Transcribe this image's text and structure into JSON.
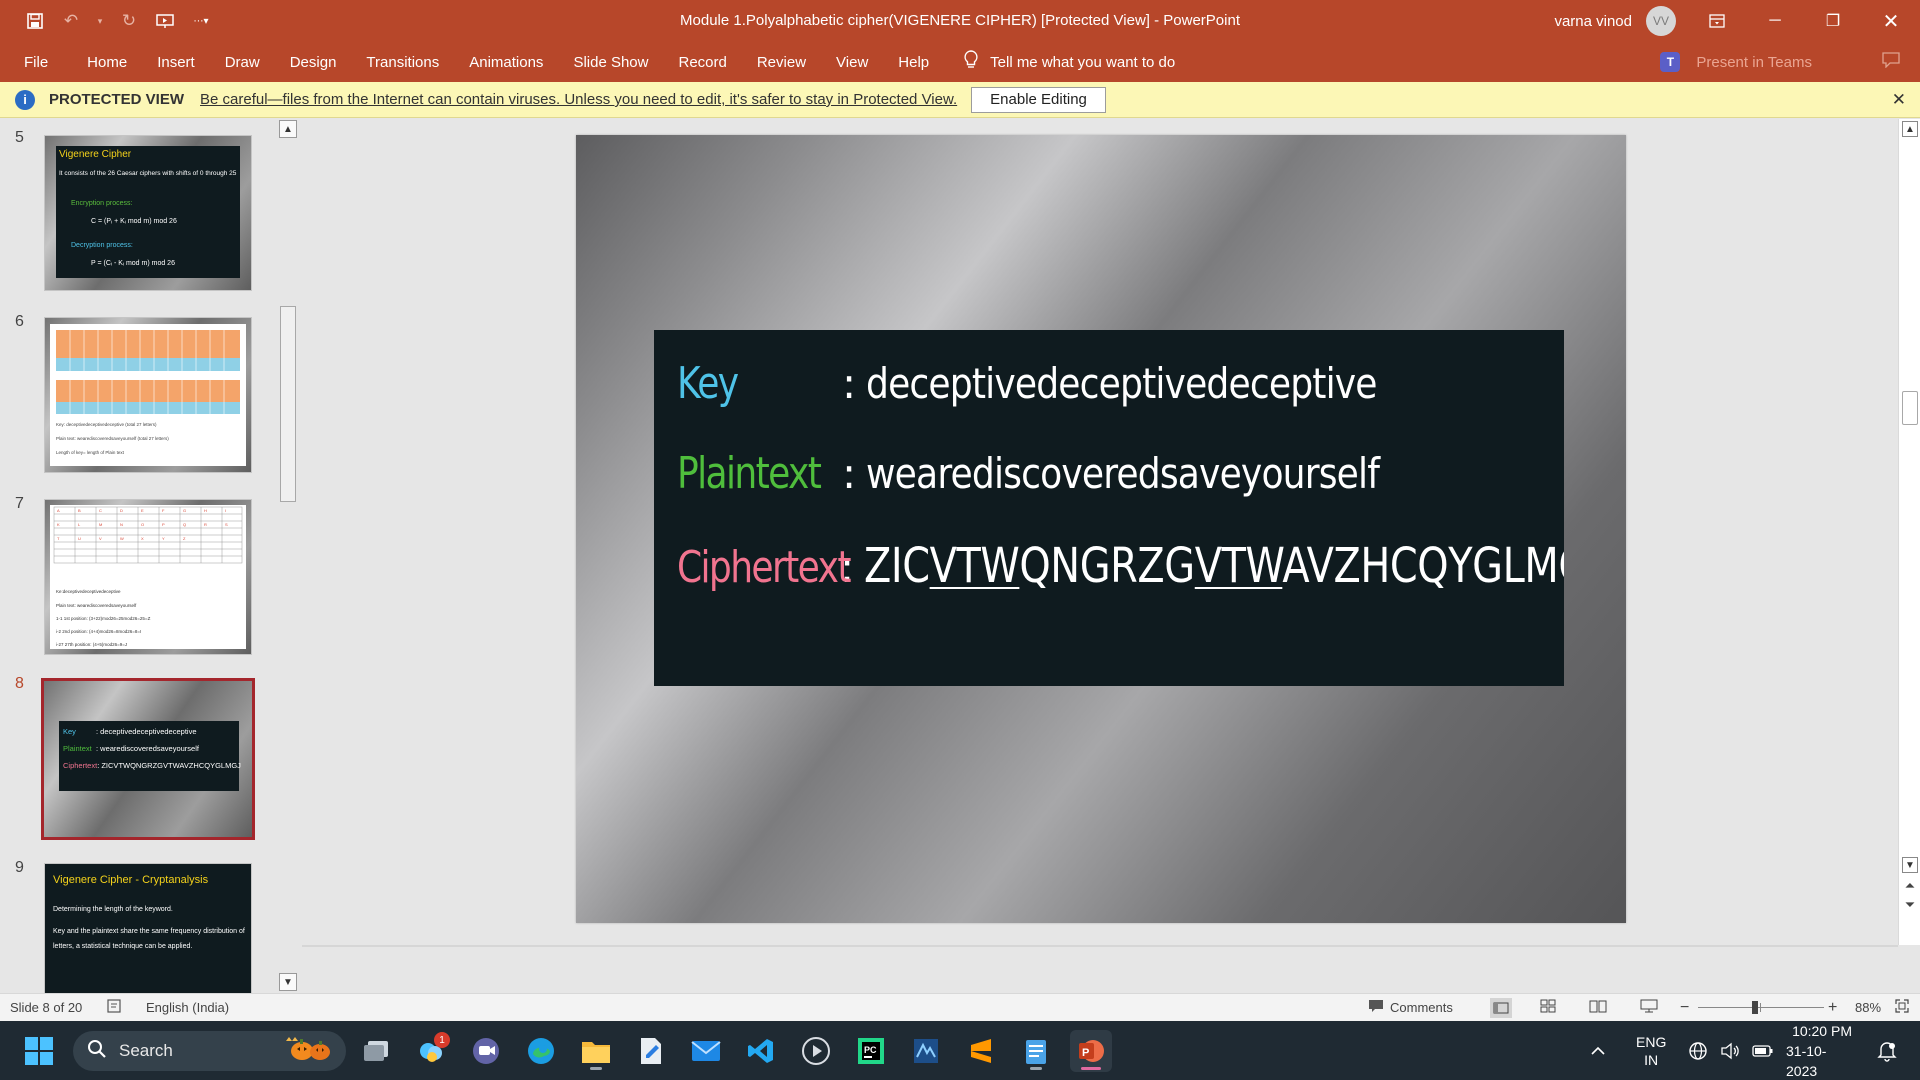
{
  "window": {
    "title": "Module 1.Polyalphabetic cipher(VIGENERE CIPHER) [Protected View]  -  PowerPoint",
    "user_name": "varna vinod",
    "user_initials": "VV"
  },
  "ribbon": {
    "file": "File",
    "tabs": [
      "Home",
      "Insert",
      "Draw",
      "Design",
      "Transitions",
      "Animations",
      "Slide Show",
      "Record",
      "Review",
      "View",
      "Help"
    ],
    "tell_me": "Tell me what you want to do",
    "present_in_teams": "Present in Teams"
  },
  "protected_view": {
    "label": "PROTECTED VIEW",
    "message": "Be careful—files from the Internet can contain viruses. Unless you need to edit, it's safer to stay in Protected View.",
    "button": "Enable Editing"
  },
  "thumbnails": [
    {
      "number": "5",
      "title": "Vigenere Cipher",
      "bullet": "It consists of the 26 Caesar ciphers with shifts of 0 through 25",
      "enc_label": "Encryption process:",
      "enc_formula": "C = (Pᵢ + Kᵢ mod m) mod 26",
      "dec_label": "Decryption process:",
      "dec_formula": "P = (Cᵢ - Kᵢ mod m) mod 26"
    },
    {
      "number": "6",
      "key_line": "Key: deceptivedeceptivedeceptive (total 27 letters)",
      "plain_line": "Plain text: wearediscoveredsaveyourself  (total 27 letters)",
      "length_line": "Length of key= length of Plain text"
    },
    {
      "number": "7",
      "key_line": "Ke:deceptivedeceptivedeceptive",
      "plain_line": "Plain text: wearediscoveredsaveyourself",
      "lines": [
        "1-1 1st position: (3+22)mod26=25mod26=25=Z",
        "i-2 2nd position: (4+4)mod26=8mod26=8=I",
        "i-27 27th position: (4+5)mod26=9=J"
      ]
    },
    {
      "number": "8",
      "key_label": "Key",
      "key_value": ": deceptivedeceptivedeceptive",
      "plain_label": "Plaintext",
      "plain_value": ": wearediscoveredsaveyourself",
      "cipher_label": "Ciphertext",
      "cipher_value": ": ZICVTWQNGRZGVTWAVZHCQYGLMGJ"
    },
    {
      "number": "9",
      "title": "Vigenere Cipher - Cryptanalysis",
      "bullet1": "Determining the length of the keyword.",
      "bullet2": "Key and the plaintext share the same frequency distribution of letters, a statistical technique can be applied."
    }
  ],
  "slide": {
    "key_label": "Key",
    "key_value": "deceptivedeceptivedeceptive",
    "plain_label": "Plaintext",
    "plain_value": "wearediscoveredsaveyourself",
    "cipher_label": "Ciphertext",
    "cipher_parts": [
      "ZIC",
      "VTW",
      "QNGRZG",
      "VTW",
      "AVZHCQYGLMGJ"
    ],
    "colon": ":",
    "colors": {
      "key": "#4fc3e8",
      "plain": "#4fbe3c",
      "cipher": "#f1748f",
      "text": "#ffffff",
      "box": "#0f1b1f"
    }
  },
  "statusbar": {
    "slide_info": "Slide 8 of 20",
    "language": "English (India)",
    "comments": "Comments",
    "zoom": "88%"
  },
  "taskbar": {
    "search": "Search",
    "lang_top": "ENG",
    "lang_bottom": "IN",
    "time": "10:20 PM",
    "date": "31-10-2023",
    "notification_count": "1"
  }
}
